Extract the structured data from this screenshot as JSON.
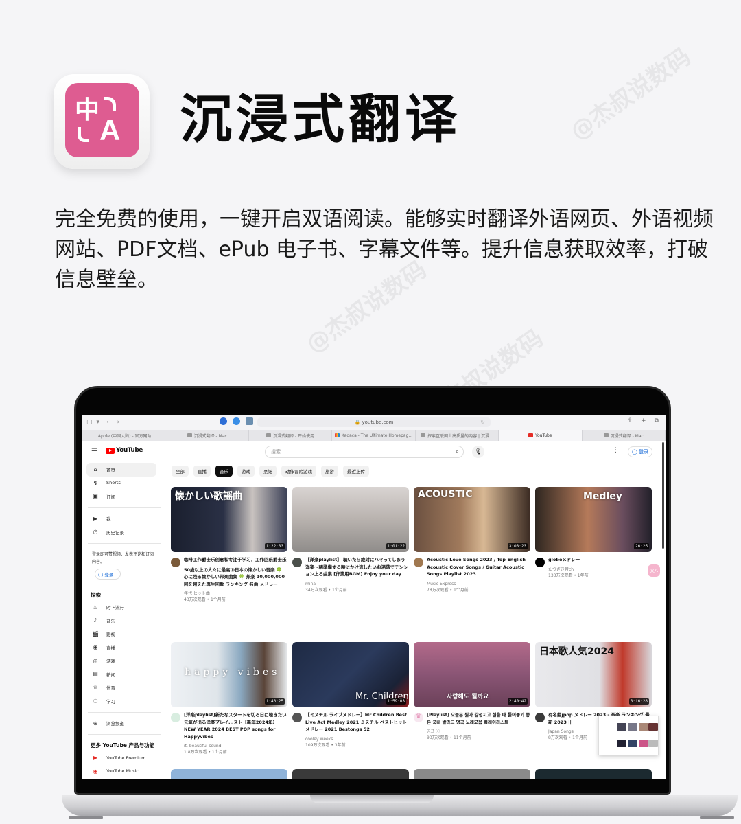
{
  "watermark": "@杰叔说数码",
  "header": {
    "app_icon": {
      "glyph_zh": "中",
      "glyph_en": "A",
      "bg_color": "#de5c91"
    },
    "title": "沉浸式翻译"
  },
  "description": "完全免费的使用，一键开启双语阅读。能够实时翻译外语网页、外语视频网站、PDF文档、ePub  电子书、字幕文件等。提升信息获取效率，打破信息壁垒。",
  "browser": {
    "toolbar": {
      "sidebar_icon": "▢",
      "back_icon": "‹",
      "forward_icon": "›",
      "address": "youtube.com",
      "share_icon": "⇧",
      "new_tab_icon": "+",
      "tabs_icon": "⧉"
    },
    "tabs": [
      {
        "label": "Apple (中国大陆) - 官方网站",
        "icon": "apple-icon",
        "active": false
      },
      {
        "label": "沉浸式翻译 - Mac",
        "icon": "page-icon",
        "active": false
      },
      {
        "label": "沉浸式翻译 - 开始使用",
        "icon": "page-icon",
        "active": false
      },
      {
        "label": "Kadaca - The Ultimate Homepag...",
        "icon": "kadaca-icon",
        "active": false
      },
      {
        "label": "探索互联网上高质量的内容 | 沉浸...",
        "icon": "page-icon",
        "active": false
      },
      {
        "label": "YouTube",
        "icon": "youtube-icon",
        "active": true
      },
      {
        "label": "沉浸式翻译 - Mac",
        "icon": "page-icon",
        "active": false
      }
    ]
  },
  "youtube": {
    "logo": "YouTube",
    "search_placeholder": "搜索",
    "signin_label": "登录",
    "sidebar": {
      "main": [
        {
          "icon": "⌂",
          "label": "首页",
          "active": true
        },
        {
          "icon": "↯",
          "label": "Shorts"
        },
        {
          "icon": "▣",
          "label": "订阅"
        }
      ],
      "you": [
        {
          "icon": "▶",
          "label": "我"
        },
        {
          "icon": "◷",
          "label": "历史记录"
        }
      ],
      "note": "登录即可赞视频、发表评论和订阅内容。",
      "signin": "登录",
      "explore_heading": "探索",
      "explore": [
        {
          "icon": "♨",
          "label": "时下流行"
        },
        {
          "icon": "♪",
          "label": "音乐"
        },
        {
          "icon": "🎬",
          "label": "影视"
        },
        {
          "icon": "◉",
          "label": "直播"
        },
        {
          "icon": "◎",
          "label": "游戏"
        },
        {
          "icon": "▤",
          "label": "新闻"
        },
        {
          "icon": "♕",
          "label": "体育"
        },
        {
          "icon": "◌",
          "label": "学习"
        }
      ],
      "browse_channels": {
        "icon": "⊕",
        "label": "浏览频道"
      },
      "more_heading": "更多 YouTube 产品与功能",
      "more": [
        {
          "icon": "▶",
          "label": "YouTube Premium"
        },
        {
          "icon": "◉",
          "label": "YouTube Music"
        }
      ]
    },
    "chips": [
      {
        "label": "全部",
        "active": false
      },
      {
        "label": "直播",
        "active": false
      },
      {
        "label": "音乐",
        "active": true
      },
      {
        "label": "游戏",
        "active": false
      },
      {
        "label": "烹饪",
        "active": false
      },
      {
        "label": "动作冒险游戏",
        "active": false
      },
      {
        "label": "旅游",
        "active": false
      },
      {
        "label": "最近上传",
        "active": false
      }
    ],
    "videos": [
      {
        "thumb_text": "懐かしい歌謡曲",
        "duration": "1:22:33",
        "title": "咖啡工作爵士乐创意和专注于学习，工作回乐爵士乐",
        "translated_title": "50歳以上の人々に最高の日本の懐かしい音楽 🍀 心に残る懐かしい邦楽曲集 🍀 邦楽 10,000,000回を超えた再生回数 ランキング 名曲 メドレー",
        "channel": "年代 ヒット曲",
        "stats": "43万次观看 • 1个月前"
      },
      {
        "thumb_text": "",
        "duration": "1:01:22",
        "title": "【洋楽playlist】 聴いたら絶対にハマってしまう洋楽～朝準備する時にかけ流したいお洒落でテンション上る曲集 [作業用BGM] Enjoy your day",
        "translated_title": "",
        "channel": "mina",
        "stats": "34万次观看 • 1个月前"
      },
      {
        "thumb_text": "ACOUSTIC",
        "duration": "3:03:23",
        "title": "Acoustic Love Songs 2023 / Top English Acoustic Cover Songs / Guitar Acoustic Songs Playlist 2023",
        "translated_title": "",
        "channel": "Music Express",
        "stats": "78万次观看 • 1个月前"
      },
      {
        "thumb_text": "Medley",
        "duration": "26:25",
        "title": "globeメドレー",
        "translated_title": "",
        "channel": "たつざき音ch",
        "stats": "133万次观看 • 1年前"
      },
      {
        "thumb_text": "happy vibes",
        "duration": "1:46:25",
        "title": "[洋楽playlist]新たなスタートを切る日に聴きたい元気が出る洋楽プレイ...スト【新年2024年】NEW YEAR 2024 BEST POP songs for Happyvibes",
        "translated_title": "",
        "channel": "it. beautiful sound",
        "stats": "1.8万次观看 • 1个月前"
      },
      {
        "thumb_text": "Mr. Children",
        "duration": "1:59:03",
        "title": "【ミスチル ライブメドレー】Mr Children Best Live Act Medley 2021 ミスチル ベストヒットメドレー 2021 Bestongs 52",
        "translated_title": "",
        "channel": "cooley weeks",
        "stats": "109万次观看 • 3年前"
      },
      {
        "thumb_text": "사랑해도 될까요",
        "duration": "2:40:42",
        "title": "[Playlist] 오늘은 뭔가 감성지고 싶을 때 틀어놓기 좋은 국내 발라드 명곡 노래모음 플레이리스트",
        "translated_title": "",
        "channel": "공그 ⓥ",
        "stats": "93万次观看 • 11个月前"
      },
      {
        "thumb_text": "日本歌人気2024",
        "duration": "3:16:28",
        "title": "有名曲jpop メドレー 2023 - 音楽 ランキング 最新 2023 ||",
        "translated_title": "",
        "channel": "Japan Songs",
        "stats": "8万次观看 • 1个月前"
      }
    ],
    "float_button_label": "文A"
  }
}
